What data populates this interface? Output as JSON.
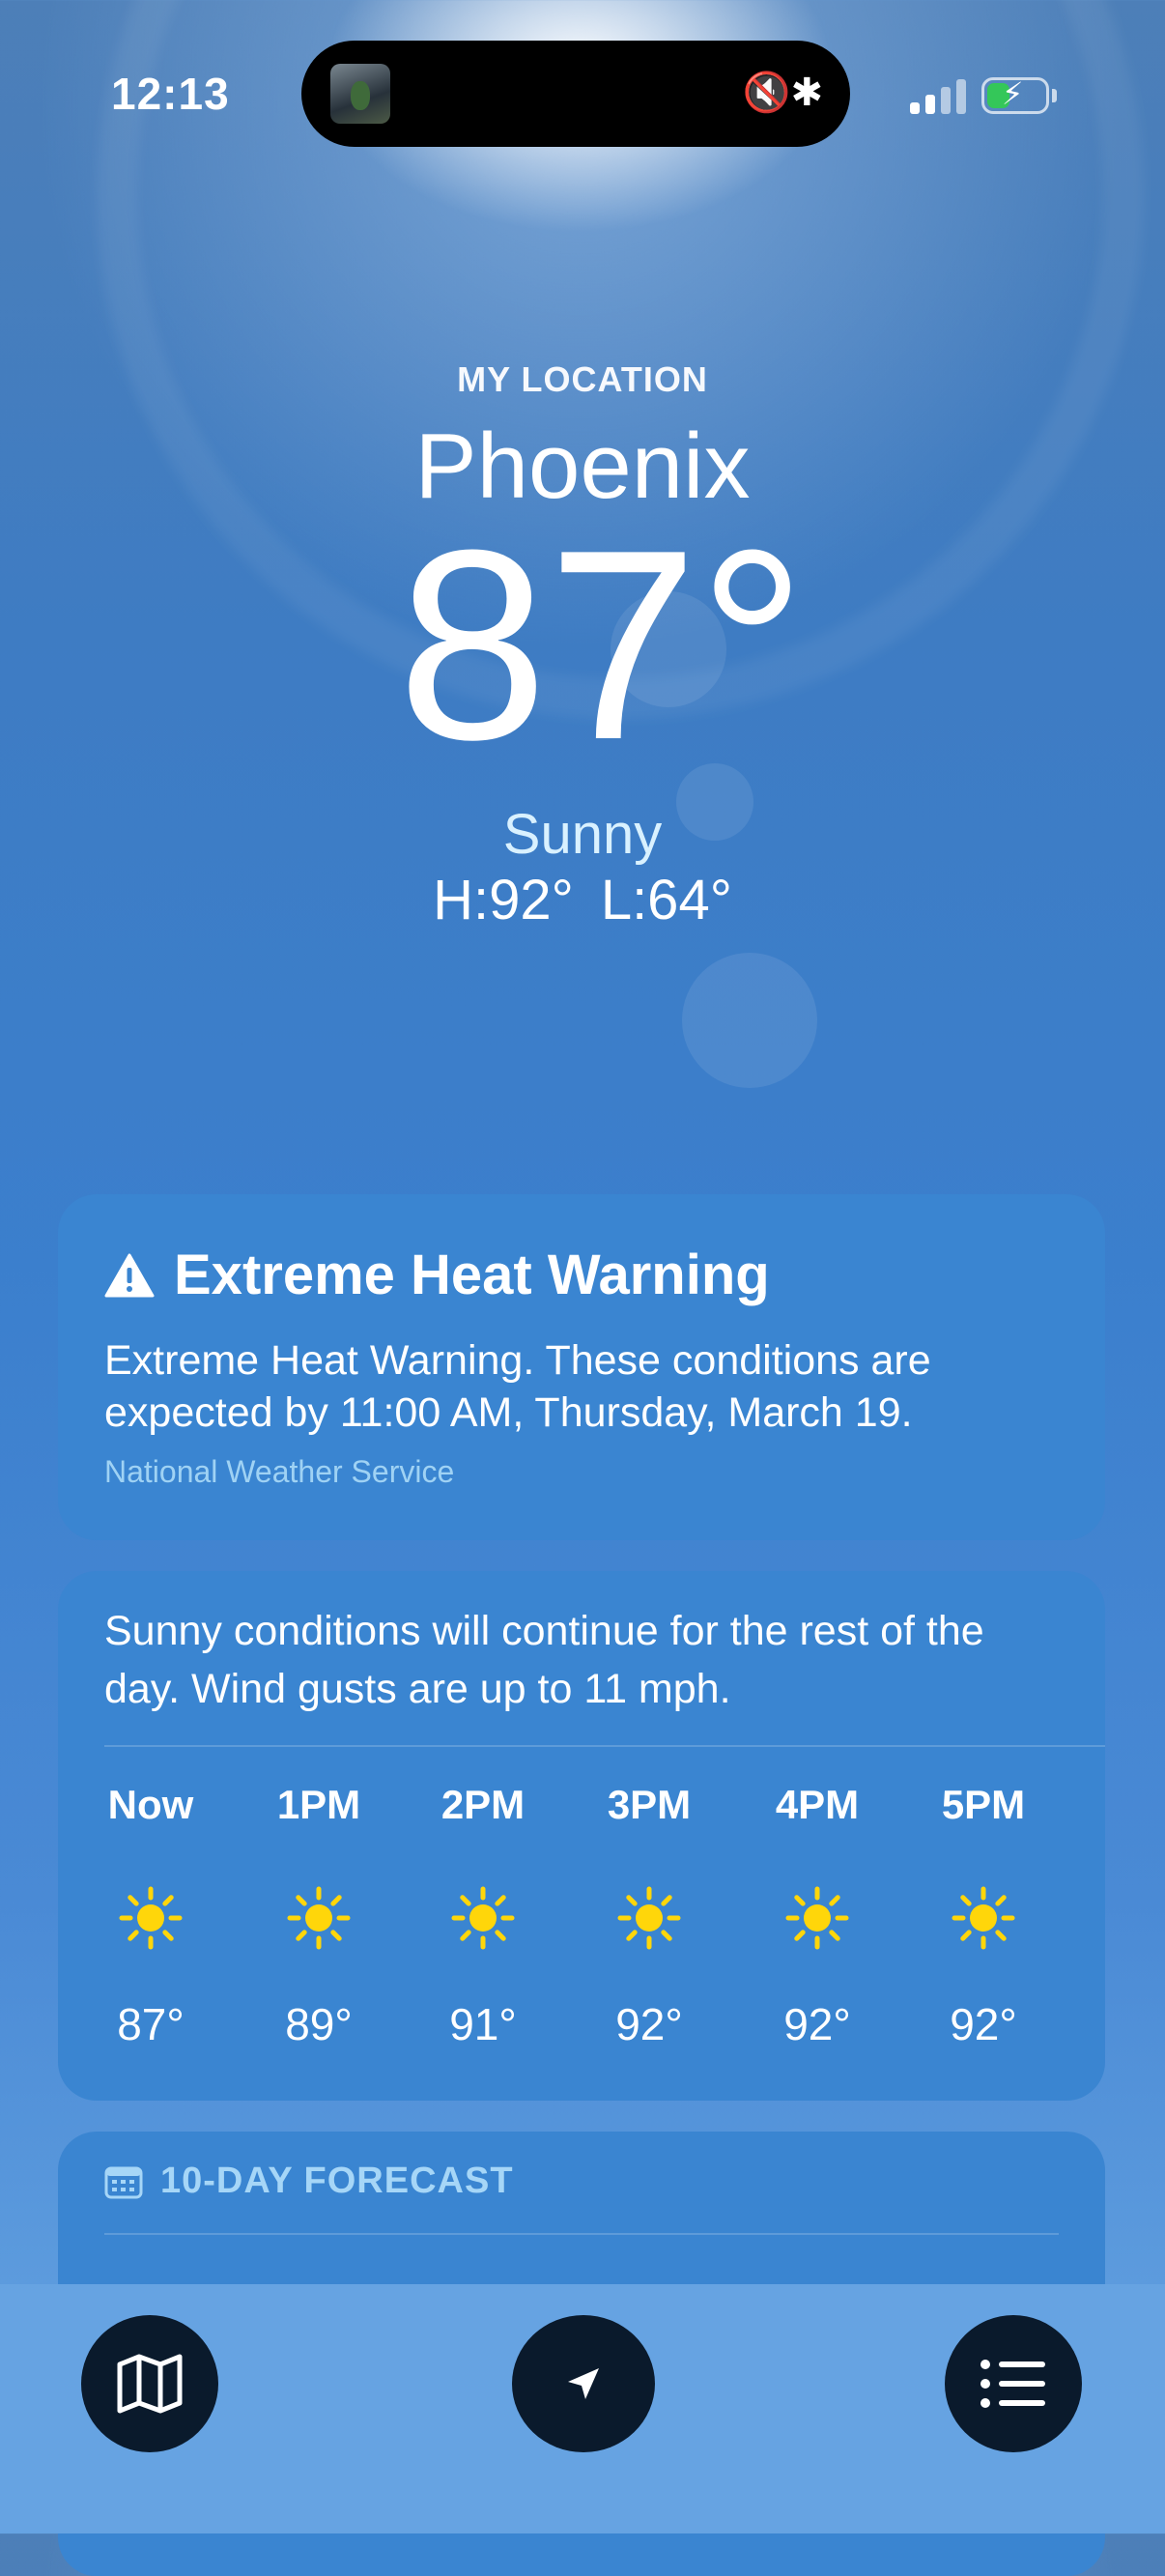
{
  "status_bar": {
    "time": "12:13",
    "island_glyphs": "🔇✱",
    "signal_bars_active": 2,
    "battery_level": 0.4,
    "battery_charging": true
  },
  "header": {
    "location_label": "MY LOCATION",
    "city": "Phoenix",
    "temperature": "87°",
    "condition": "Sunny",
    "high": "H:92°",
    "low": "L:64°"
  },
  "alert": {
    "title": "Extreme Heat Warning",
    "body": "Extreme Heat Warning. These conditions are expected by 11:00 AM, Thursday, March 19.",
    "source": "National Weather Service",
    "icon": "warning-triangle-icon"
  },
  "hourly": {
    "summary": "Sunny conditions will continue for the rest of the day. Wind gusts are up to 11 mph.",
    "hours": [
      {
        "label": "Now",
        "temp": "87°",
        "icon": "sun-icon"
      },
      {
        "label": "1PM",
        "temp": "89°",
        "icon": "sun-icon"
      },
      {
        "label": "2PM",
        "temp": "91°",
        "icon": "sun-icon"
      },
      {
        "label": "3PM",
        "temp": "92°",
        "icon": "sun-icon"
      },
      {
        "label": "4PM",
        "temp": "92°",
        "icon": "sun-icon"
      },
      {
        "label": "5PM",
        "temp": "92°",
        "icon": "sun-icon"
      }
    ]
  },
  "forecast": {
    "title": "10-DAY FORECAST",
    "icon": "calendar-icon"
  },
  "bottom_bar": {
    "buttons": [
      "map-icon",
      "location-arrow-icon",
      "list-icon"
    ]
  },
  "colors": {
    "card": "#3a85d1",
    "sun": "#ffd60a",
    "source_text": "#9fd2f4",
    "button_bg": "#0a1a2c"
  }
}
